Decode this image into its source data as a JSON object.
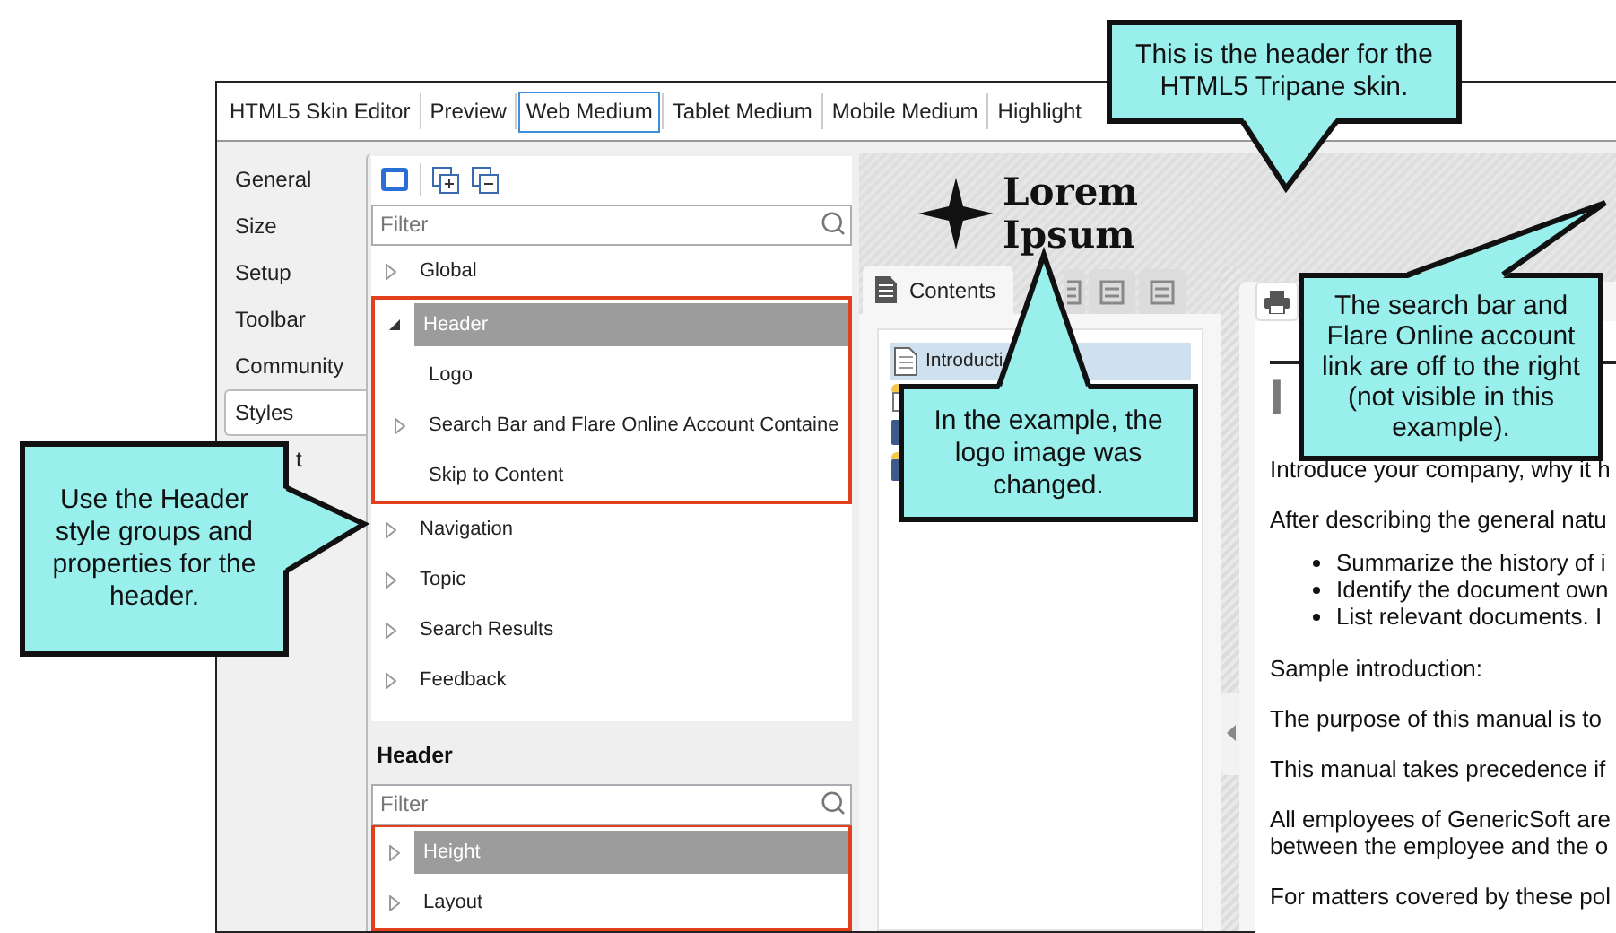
{
  "window_tabs": [
    {
      "label": "HTML5 Skin Editor",
      "selected": false
    },
    {
      "label": "Preview",
      "selected": false
    },
    {
      "label": "Web Medium",
      "selected": true
    },
    {
      "label": "Tablet Medium",
      "selected": false
    },
    {
      "label": "Mobile Medium",
      "selected": false
    },
    {
      "label": "Highlight",
      "selected": false
    }
  ],
  "sidebar": {
    "items": [
      {
        "label": "General",
        "selected": false
      },
      {
        "label": "Size",
        "selected": false
      },
      {
        "label": "Setup",
        "selected": false
      },
      {
        "label": "Toolbar",
        "selected": false
      },
      {
        "label": "Community",
        "selected": false
      },
      {
        "label": "Styles",
        "selected": true
      },
      {
        "label": "t",
        "selected": false
      }
    ]
  },
  "style_groups": {
    "filter": {
      "placeholder": "Filter"
    },
    "items": [
      {
        "label": "Global",
        "expandable": true,
        "expanded": false,
        "selected": false,
        "highlighted": false
      },
      {
        "label": "Header",
        "expandable": true,
        "expanded": true,
        "selected": true,
        "highlighted": true,
        "children": [
          {
            "label": "Logo",
            "expandable": false,
            "selected": false
          },
          {
            "label": "Search Bar and Flare Online Account Containe",
            "expandable": true,
            "expanded": false,
            "selected": false
          },
          {
            "label": "Skip to Content",
            "expandable": false,
            "selected": false
          }
        ]
      },
      {
        "label": "Navigation",
        "expandable": true,
        "expanded": false,
        "selected": false,
        "highlighted": false
      },
      {
        "label": "Topic",
        "expandable": true,
        "expanded": false,
        "selected": false,
        "highlighted": false
      },
      {
        "label": "Search Results",
        "expandable": true,
        "expanded": false,
        "selected": false,
        "highlighted": false
      },
      {
        "label": "Feedback",
        "expandable": true,
        "expanded": false,
        "selected": false,
        "highlighted": false
      }
    ]
  },
  "properties": {
    "title": "Header",
    "filter": {
      "placeholder": "Filter"
    },
    "highlighted": true,
    "items": [
      {
        "label": "Height",
        "expanded": false,
        "selected": true
      },
      {
        "label": "Layout",
        "expanded": false,
        "selected": false
      }
    ]
  },
  "preview": {
    "logo_text": "Lorem Ipsum",
    "nav_tabs": [
      {
        "label": "Contents",
        "selected": true
      },
      {
        "selected": false
      },
      {
        "selected": false
      },
      {
        "selected": false
      }
    ],
    "toc": [
      {
        "label": "Introducti",
        "selected": true
      }
    ],
    "topic": {
      "heading": "I",
      "blocks": [
        {
          "kind": "paragraph",
          "lines": [
            "Introduce your company, why it h"
          ]
        },
        {
          "kind": "paragraph",
          "lines": [
            "After describing the general natu"
          ]
        },
        {
          "kind": "bullets",
          "items": [
            "Summarize the history of i",
            "Identify the document own",
            "List relevant documents. I"
          ]
        },
        {
          "kind": "paragraph",
          "lines": [
            "Sample introduction:"
          ]
        },
        {
          "kind": "paragraph",
          "lines": [
            "The purpose of this manual is to"
          ]
        },
        {
          "kind": "paragraph",
          "lines": [
            "This manual takes precedence if"
          ]
        },
        {
          "kind": "paragraph",
          "lines": [
            "All employees of GenericSoft are",
            "between the employee and the o"
          ]
        },
        {
          "kind": "paragraph",
          "lines": [
            "For matters covered by these pol"
          ]
        }
      ]
    }
  },
  "callouts": [
    {
      "text": "This is the header for the HTML5 Tripane skin."
    },
    {
      "text": "Use the Header style groups and properties for the header."
    },
    {
      "text": "In the example, the logo image was changed."
    },
    {
      "text": "The search bar and Flare Online account link are off to the right (not visible in this example)."
    }
  ]
}
